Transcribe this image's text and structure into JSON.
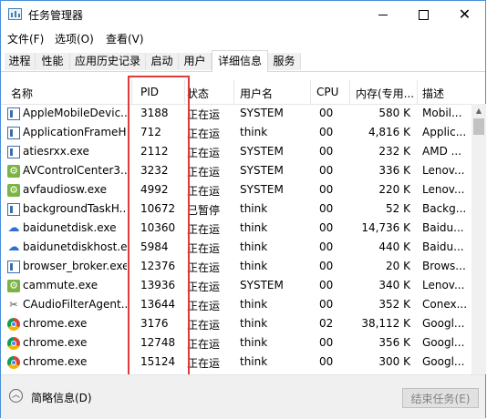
{
  "window": {
    "title": "任务管理器"
  },
  "menu": [
    "文件(F)",
    "选项(O)",
    "查看(V)"
  ],
  "tabs": [
    {
      "label": "进程",
      "active": false
    },
    {
      "label": "性能",
      "active": false
    },
    {
      "label": "应用历史记录",
      "active": false
    },
    {
      "label": "启动",
      "active": false
    },
    {
      "label": "用户",
      "active": false
    },
    {
      "label": "详细信息",
      "active": true
    },
    {
      "label": "服务",
      "active": false
    }
  ],
  "columns": {
    "name": "名称",
    "pid": "PID",
    "status": "状态",
    "user": "用户名",
    "cpu": "CPU",
    "memory": "内存(专用...",
    "description": "描述"
  },
  "rows": [
    {
      "icon": "app-window-icon",
      "name": "AppleMobileDevic...",
      "pid": "3188",
      "status": "正在运",
      "user": "SYSTEM",
      "cpu": "00",
      "memory": "580 K",
      "description": "Mobil..."
    },
    {
      "icon": "app-window-icon",
      "name": "ApplicationFrameH...",
      "pid": "712",
      "status": "正在运",
      "user": "think",
      "cpu": "00",
      "memory": "4,816 K",
      "description": "Applic..."
    },
    {
      "icon": "app-window-icon",
      "name": "atiesrxx.exe",
      "pid": "2112",
      "status": "正在运",
      "user": "SYSTEM",
      "cpu": "00",
      "memory": "232 K",
      "description": "AMD ..."
    },
    {
      "icon": "gear-icon",
      "name": "AVControlCenter3...",
      "pid": "3232",
      "status": "正在运",
      "user": "SYSTEM",
      "cpu": "00",
      "memory": "336 K",
      "description": "Lenov..."
    },
    {
      "icon": "gear-icon",
      "name": "avfaudiosw.exe",
      "pid": "4992",
      "status": "正在运",
      "user": "SYSTEM",
      "cpu": "00",
      "memory": "220 K",
      "description": "Lenov..."
    },
    {
      "icon": "app-window-icon",
      "name": "backgroundTaskH...",
      "pid": "10672",
      "status": "已暂停",
      "user": "think",
      "cpu": "00",
      "memory": "52 K",
      "description": "Backg..."
    },
    {
      "icon": "cloud-icon",
      "name": "baidunetdisk.exe",
      "pid": "10360",
      "status": "正在运",
      "user": "think",
      "cpu": "00",
      "memory": "14,736 K",
      "description": "Baidu..."
    },
    {
      "icon": "cloud-icon",
      "name": "baidunetdiskhost.e...",
      "pid": "5984",
      "status": "正在运",
      "user": "think",
      "cpu": "00",
      "memory": "440 K",
      "description": "Baidu..."
    },
    {
      "icon": "app-window-icon",
      "name": "browser_broker.exe",
      "pid": "12376",
      "status": "正在运",
      "user": "think",
      "cpu": "00",
      "memory": "20 K",
      "description": "Brows..."
    },
    {
      "icon": "gear-icon",
      "name": "cammute.exe",
      "pid": "13936",
      "status": "正在运",
      "user": "SYSTEM",
      "cpu": "00",
      "memory": "340 K",
      "description": "Lenov..."
    },
    {
      "icon": "tools-icon",
      "name": "CAudioFilterAgent...",
      "pid": "13644",
      "status": "正在运",
      "user": "think",
      "cpu": "00",
      "memory": "352 K",
      "description": "Conex..."
    },
    {
      "icon": "chrome-icon",
      "name": "chrome.exe",
      "pid": "3176",
      "status": "正在运",
      "user": "think",
      "cpu": "02",
      "memory": "38,112 K",
      "description": "Googl..."
    },
    {
      "icon": "chrome-icon",
      "name": "chrome.exe",
      "pid": "12748",
      "status": "正在运",
      "user": "think",
      "cpu": "00",
      "memory": "356 K",
      "description": "Googl..."
    },
    {
      "icon": "chrome-icon",
      "name": "chrome.exe",
      "pid": "15124",
      "status": "正在运",
      "user": "think",
      "cpu": "00",
      "memory": "300 K",
      "description": "Googl..."
    }
  ],
  "footer": {
    "fewer_details": "简略信息(D)",
    "end_task": "结束任务(E)"
  },
  "colors": {
    "highlight_box": "#e03a3a",
    "window_border": "#4a90d9"
  }
}
